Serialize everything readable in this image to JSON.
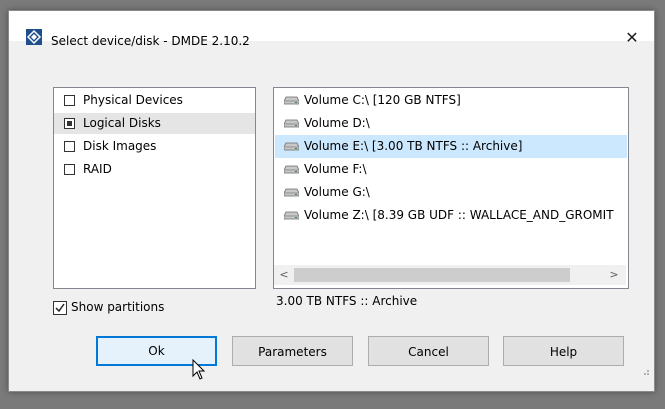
{
  "window": {
    "title": "Select device/disk - DMDE 2.10.2",
    "close_glyph": "✕",
    "icon": "dmde-app-icon"
  },
  "device_types": [
    {
      "label": "Physical Devices",
      "checked": false,
      "selected": false
    },
    {
      "label": "Logical Disks",
      "checked": true,
      "selected": true
    },
    {
      "label": "Disk Images",
      "checked": false,
      "selected": false
    },
    {
      "label": "RAID",
      "checked": false,
      "selected": false
    }
  ],
  "volumes": [
    {
      "label": "Volume C:\\ [120 GB NTFS]",
      "selected": false,
      "icon": "drive-icon"
    },
    {
      "label": "Volume D:\\",
      "selected": false,
      "icon": "drive-icon"
    },
    {
      "label": "Volume E:\\ [3.00 TB NTFS :: Archive]",
      "selected": true,
      "icon": "drive-icon"
    },
    {
      "label": "Volume F:\\",
      "selected": false,
      "icon": "drive-icon"
    },
    {
      "label": "Volume G:\\",
      "selected": false,
      "icon": "drive-icon"
    },
    {
      "label": "Volume Z:\\ [8.39 GB UDF :: WALLACE_AND_GROMIT",
      "selected": false,
      "icon": "drive-icon"
    }
  ],
  "scrollbar": {
    "left_arrow": "<",
    "right_arrow": ">"
  },
  "status_text": "3.00 TB NTFS :: Archive",
  "show_partitions": {
    "label": "Show partitions",
    "checked": true
  },
  "buttons": {
    "ok": "Ok",
    "parameters": "Parameters",
    "cancel": "Cancel",
    "help": "Help"
  },
  "colors": {
    "selection": "#cce8ff",
    "list_selection": "#e5e5e5",
    "default_button_border": "#0078d7"
  }
}
